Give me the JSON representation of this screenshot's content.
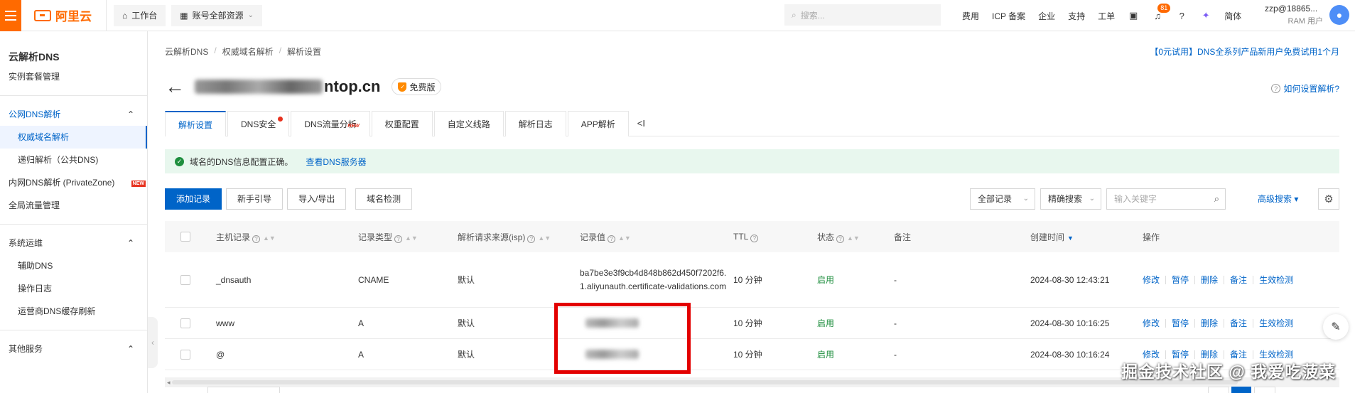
{
  "topbar": {
    "logo_text": "阿里云",
    "workbench": "工作台",
    "resources": "账号全部资源",
    "search_placeholder": "搜索...",
    "nav": [
      "费用",
      "ICP 备案",
      "企业",
      "支持",
      "工单"
    ],
    "notification_count": "81",
    "lang": "简体",
    "user_name": "zzp@18865...",
    "user_role": "RAM 用户"
  },
  "sidebar": {
    "title": "云解析DNS",
    "instance_mgmt": "实例套餐管理",
    "group_public": "公网DNS解析",
    "authoritative": "权威域名解析",
    "recursive": "递归解析（公共DNS)",
    "private_zone": "内网DNS解析 (PrivateZone)",
    "new_tag": "NEW",
    "global_traffic": "全局流量管理",
    "group_ops": "系统运维",
    "aux_dns": "辅助DNS",
    "op_log": "操作日志",
    "isp_refresh": "运营商DNS缓存刷新",
    "group_other": "其他服务"
  },
  "main": {
    "breadcrumb": [
      "云解析DNS",
      "权威域名解析",
      "解析设置"
    ],
    "promo": "【0元试用】DNS全系列产品新用户免费试用1个月",
    "domain_tail": "ntop.cn",
    "free_badge": "免费版",
    "help": "如何设置解析?",
    "tabs": [
      "解析设置",
      "DNS安全",
      "DNS流量分析",
      "权重配置",
      "自定义线路",
      "解析日志",
      "APP解析"
    ],
    "tab_new": "NEW",
    "tab_collapse": "<I",
    "alert_text": "域名的DNS信息配置正确。",
    "alert_link": "查看DNS服务器",
    "toolbar": {
      "add": "添加记录",
      "guide": "新手引导",
      "import_export": "导入/导出",
      "check": "域名检测",
      "all_records": "全部记录",
      "exact_search": "精确搜索",
      "keyword_placeholder": "输入关键字",
      "advanced": "高级搜索"
    },
    "table": {
      "headers": {
        "host": "主机记录",
        "type": "记录类型",
        "isp": "解析请求来源(isp)",
        "value": "记录值",
        "ttl": "TTL",
        "status": "状态",
        "remark": "备注",
        "created": "创建时间",
        "actions": "操作"
      },
      "rows": [
        {
          "host": "_dnsauth",
          "type": "CNAME",
          "isp": "默认",
          "value": "ba7be3e3f9cb4d848b862d450f7202f6.1.aliyunauth.certificate-validations.com",
          "ttl": "10 分钟",
          "status": "启用",
          "remark": "-",
          "created": "2024-08-30 12:43:21"
        },
        {
          "host": "www",
          "type": "A",
          "isp": "默认",
          "value": "",
          "ttl": "10 分钟",
          "status": "启用",
          "remark": "-",
          "created": "2024-08-30 10:16:25"
        },
        {
          "host": "@",
          "type": "A",
          "isp": "默认",
          "value": "",
          "ttl": "10 分钟",
          "status": "启用",
          "remark": "-",
          "created": "2024-08-30 10:16:24"
        }
      ],
      "actions": [
        "修改",
        "暂停",
        "删除",
        "备注",
        "生效检测"
      ]
    }
  },
  "watermark": "掘金技术社区 @ 我爱吃菠菜",
  "colors": {
    "brand": "#ff6a00",
    "primary": "#0064c8",
    "success": "#1e8e3e",
    "highlight": "#e30000"
  }
}
